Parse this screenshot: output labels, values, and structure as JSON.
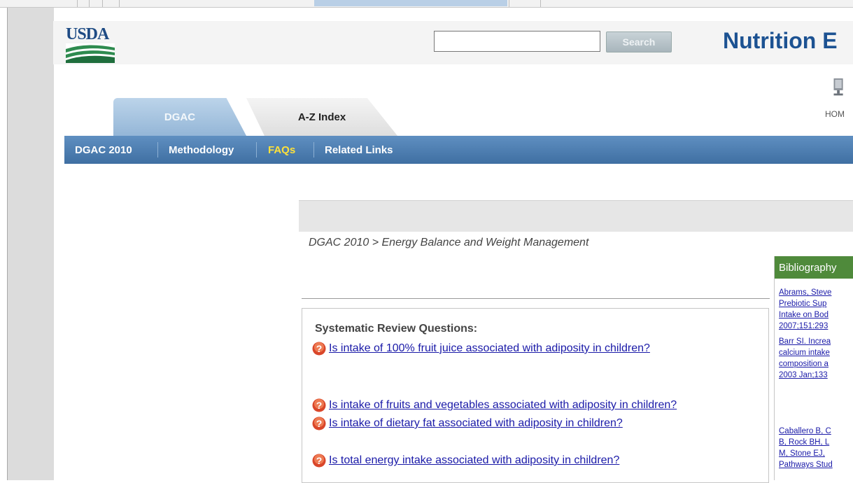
{
  "header": {
    "logo_text": "USDA",
    "search": {
      "placeholder": "",
      "value": "",
      "button_label": "Search"
    },
    "site_title": "Nutrition E"
  },
  "tabs": [
    {
      "label": "DGAC",
      "active": true
    },
    {
      "label": "A-Z Index",
      "active": false
    }
  ],
  "home": {
    "label": "HOM",
    "icon": "monitor-icon"
  },
  "nav": [
    {
      "label": "DGAC 2010",
      "active": false
    },
    {
      "label": "Methodology",
      "active": false
    },
    {
      "label": "FAQs",
      "active": true
    },
    {
      "label": "Related Links",
      "active": false
    }
  ],
  "breadcrumb": "DGAC 2010 > Energy Balance and Weight Management",
  "questions": {
    "title": "Systematic Review Questions:",
    "items": [
      "Is intake of 100% fruit juice associated with adiposity in children?",
      "Is intake of fruits and vegetables associated with adiposity in children?",
      "Is intake of dietary fat associated with adiposity in children?",
      "Is total energy intake associated with adiposity in children?"
    ],
    "icon": "question-icon"
  },
  "bibliography": {
    "title": "Bibliography",
    "refs": [
      [
        "Abrams, Steve",
        "Prebiotic Sup",
        "Intake on Bod",
        "2007;151:293"
      ],
      [
        "Barr SI. Increa",
        "calcium intake",
        "composition a",
        "2003 Jan;133"
      ],
      [
        "Caballero B, C",
        "B, Rock BH, L",
        "M, Stone EJ,",
        "Pathways Stud"
      ]
    ]
  },
  "colors": {
    "nav_bar": "#4f7fb2",
    "active_nav": "#ffe13a",
    "link": "#1a1aa8",
    "title": "#1c5292",
    "bibliography_header": "#4f8a3b"
  }
}
